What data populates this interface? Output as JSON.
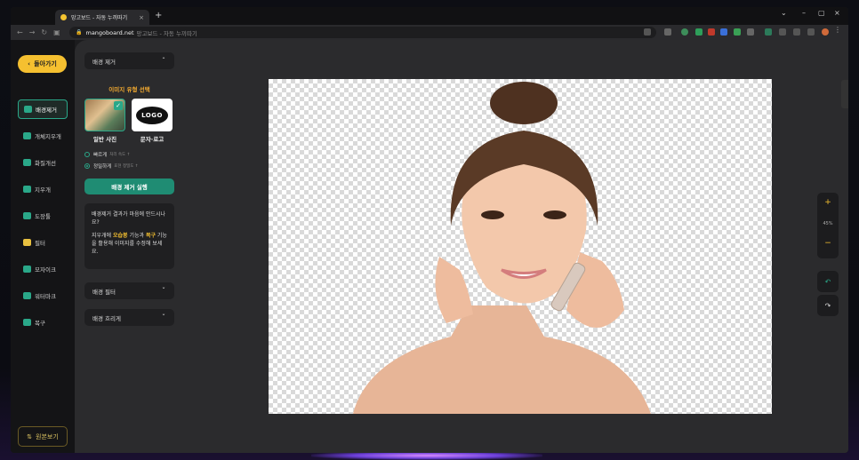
{
  "browser": {
    "tab_title": "망고보드 - 자동 누끼따기",
    "new_tab": "+",
    "tab_close": "×",
    "window_controls": [
      "⌄",
      "–",
      "▢",
      "×"
    ],
    "url_host": "mangoboard.net",
    "url_title": "망고보드 - 자동 누끼따기"
  },
  "leftnav": {
    "back_label": "돌아가기",
    "items": [
      {
        "label": "배경제거",
        "active": true,
        "icon": "background-remove-icon",
        "color": "#2aa889"
      },
      {
        "label": "개체지우개",
        "active": false,
        "icon": "object-eraser-icon",
        "color": "#2aa889"
      },
      {
        "label": "화질개선",
        "active": false,
        "icon": "quality-enhance-icon",
        "color": "#2aa889"
      },
      {
        "label": "지우개",
        "active": false,
        "icon": "eraser-icon",
        "color": "#2aa889"
      },
      {
        "label": "도장툴",
        "active": false,
        "icon": "stamp-icon",
        "color": "#2aa889"
      },
      {
        "label": "필터",
        "active": false,
        "icon": "filter-icon",
        "color": "#e8c040"
      },
      {
        "label": "모자이크",
        "active": false,
        "icon": "mosaic-icon",
        "color": "#2aa889"
      },
      {
        "label": "워터마크",
        "active": false,
        "icon": "watermark-icon",
        "color": "#2aa889"
      },
      {
        "label": "복구",
        "active": false,
        "icon": "restore-icon",
        "color": "#2aa889"
      }
    ],
    "original_label": "원본보기"
  },
  "panel": {
    "section_title": "배경 제거",
    "image_type_heading": "이미지 유형 선택",
    "type_photo_label": "일반 사진",
    "type_logo_label": "문자·로고",
    "logo_text": "LOGO",
    "mode_fast_label": "빠르게",
    "mode_fast_sub": "처리 속도 ↑",
    "mode_precise_label": "정밀하게",
    "mode_precise_sub": "표현 정밀도 ↑",
    "run_button": "배경 제거 실행",
    "info_q": "배경제거 결과가 마음에 안드시나요?",
    "info_a_pre": "지우개에 ",
    "info_a_hl1": "오습봉",
    "info_a_mid": " 기능과 ",
    "info_a_hl2": "복구",
    "info_a_post": " 기능을 활용해 이미지를 수정해 보세요.",
    "bg_filter_label": "배경 필터",
    "bg_blur_label": "배경 흐리게"
  },
  "canvas": {
    "zoom_plus": "+",
    "zoom_value": "45%",
    "zoom_minus": "−",
    "undo_icon": "undo-icon",
    "redo_icon": "redo-icon"
  },
  "colors": {
    "accent": "#f5c030",
    "teal": "#2aa889"
  }
}
